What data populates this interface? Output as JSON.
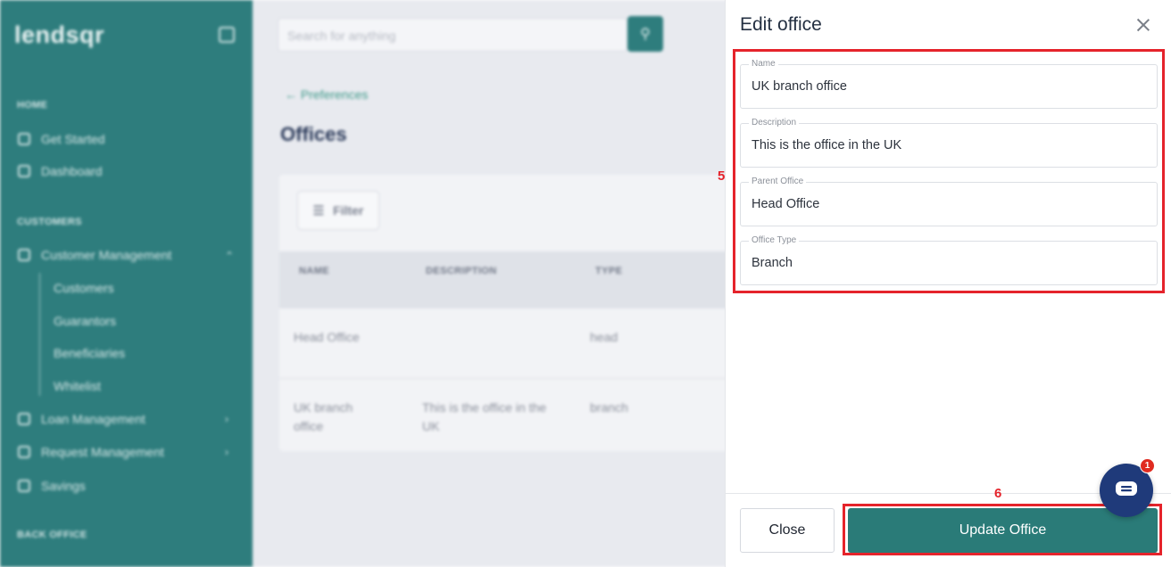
{
  "app": {
    "logo_text": "lendsqr",
    "search_placeholder": "Search for anything",
    "sidebar": {
      "section_home": "HOME",
      "get_started": "Get Started",
      "dashboard": "Dashboard",
      "section_customers": "CUSTOMERS",
      "customer_management": "Customer Management",
      "sub_items": [
        "Customers",
        "Guarantors",
        "Beneficiaries",
        "Whitelist"
      ],
      "loan_management": "Loan Management",
      "request_management": "Request Management",
      "savings": "Savings",
      "section_back_office": "BACK OFFICE"
    },
    "breadcrumb": "Preferences",
    "page_title": "Offices",
    "filter_label": "Filter",
    "table": {
      "columns": [
        "NAME",
        "DESCRIPTION",
        "TYPE"
      ],
      "rows": [
        [
          "Head Office",
          "",
          "head"
        ],
        [
          "UK branch office",
          "This is the office in the UK",
          "branch"
        ]
      ]
    }
  },
  "drawer": {
    "title": "Edit office",
    "fields": {
      "name": {
        "label": "Name",
        "value": "UK branch office"
      },
      "description": {
        "label": "Description",
        "value": "This is the office in the UK"
      },
      "parent_office": {
        "label": "Parent Office",
        "value": "Head Office"
      },
      "office_type": {
        "label": "Office Type",
        "value": "Branch"
      }
    },
    "close_label": "Close",
    "update_label": "Update Office"
  },
  "annotations": {
    "fields_number": "5",
    "button_number": "6"
  },
  "chat": {
    "badge_count": "1"
  },
  "colors": {
    "accent": "#2a7b78",
    "highlight": "#e5232b",
    "chat": "#1f3a7a"
  }
}
